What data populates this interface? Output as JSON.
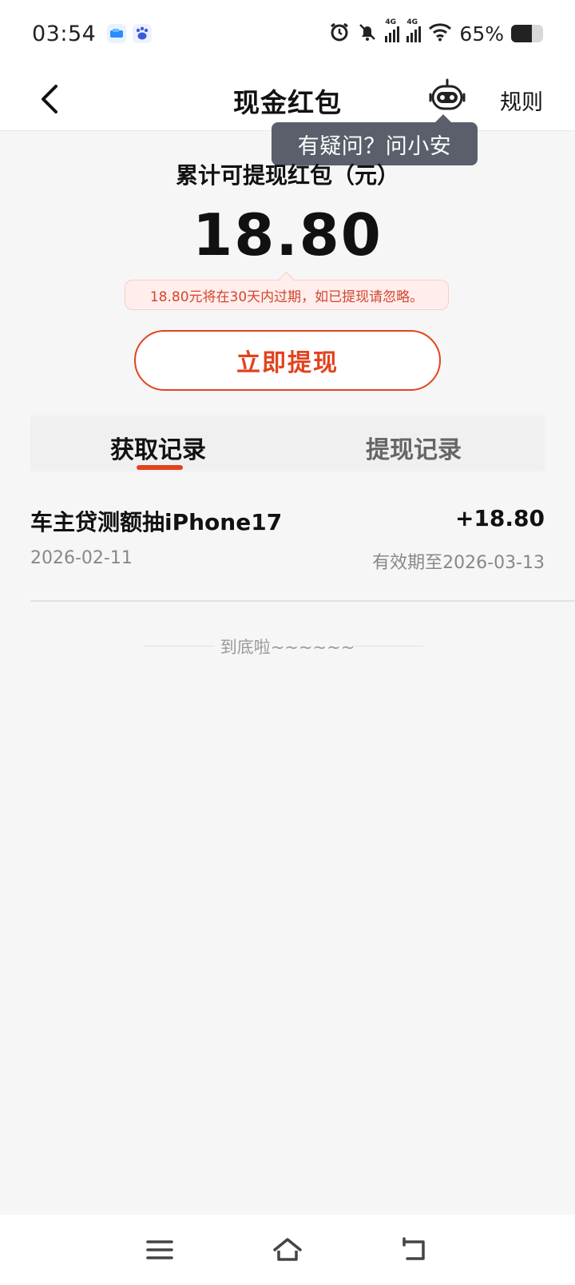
{
  "status_bar": {
    "time": "03:54",
    "network_1": "4G",
    "network_2": "4G",
    "battery_percent": "65%",
    "battery_level": 0.65
  },
  "nav": {
    "title": "现金红包",
    "rules_label": "规则",
    "tooltip": "有疑问？问小安"
  },
  "summary": {
    "label": "累计可提现红包（元）",
    "amount": "18.80",
    "expire_note": "18.80元将在30天内过期，如已提现请忽略。",
    "withdraw_button": "立即提现"
  },
  "tabs": {
    "items": [
      {
        "label": "获取记录",
        "active": true
      },
      {
        "label": "提现记录",
        "active": false
      }
    ]
  },
  "records": [
    {
      "title": "车主贷测额抽iPhone17",
      "amount": "+18.80",
      "date": "2026-02-11",
      "expiry": "有效期至2026-03-13"
    }
  ],
  "list_end": "到底啦~~~~~~",
  "colors": {
    "accent": "#e2431f",
    "tooltip_bg": "#5b5f6c"
  }
}
